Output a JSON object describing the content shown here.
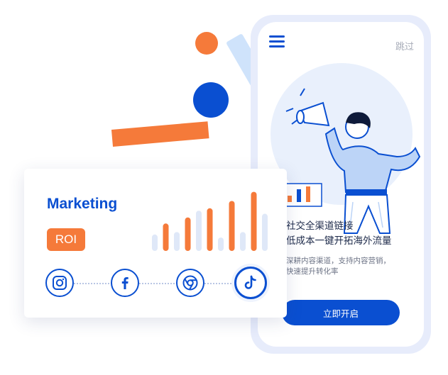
{
  "colors": {
    "brand_blue": "#0a4fd1",
    "accent_orange": "#f57a3a",
    "light_blue": "#e9f0fc",
    "bar_pale": "#dfe8f8"
  },
  "phone": {
    "skip_label": "跳过",
    "headline": "社交全渠道链接\n低成本一键开拓海外流量",
    "subtext": "深耕内容渠道，支持内容营销，\n快速提升转化率",
    "cta_label": "立即开启",
    "menu_icon": "hamburger-menu-icon"
  },
  "card": {
    "title": "Marketing",
    "badge": "ROI",
    "bars": [
      {
        "level": 0.27,
        "highlight": false
      },
      {
        "level": 0.45,
        "highlight": true
      },
      {
        "level": 0.31,
        "highlight": false
      },
      {
        "level": 0.55,
        "highlight": true
      },
      {
        "level": 0.66,
        "highlight": false
      },
      {
        "level": 0.7,
        "highlight": true
      },
      {
        "level": 0.22,
        "highlight": false
      },
      {
        "level": 0.82,
        "highlight": true
      },
      {
        "level": 0.31,
        "highlight": false
      },
      {
        "level": 0.97,
        "highlight": true
      },
      {
        "level": 0.61,
        "highlight": false
      }
    ],
    "social_icons": [
      "instagram-icon",
      "facebook-icon",
      "chrome-icon",
      "tiktok-icon"
    ]
  }
}
